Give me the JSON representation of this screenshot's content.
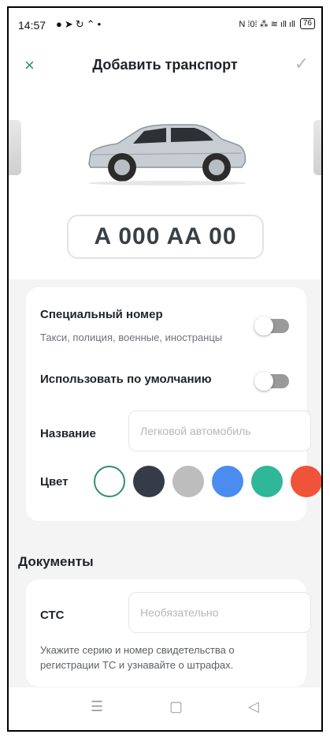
{
  "status_bar": {
    "time": "14:57",
    "left_icons": [
      "message-icon",
      "navigation-icon",
      "sync-icon",
      "up-arrow-icon",
      "dot-icon"
    ],
    "right_text": "N ⁞0⁞ ⁂ ≋ ıll ıll",
    "battery": "76"
  },
  "app_bar": {
    "close_icon": "×",
    "title": "Добавить транспорт",
    "confirm_icon": "✓"
  },
  "plate": {
    "number": "A 000 AA 00"
  },
  "settings": {
    "special_number": {
      "label": "Специальный номер",
      "subtitle": "Такси, полиция, военные, иностранцы",
      "enabled": false
    },
    "use_default": {
      "label": "Использовать по умолчанию",
      "enabled": false
    },
    "name": {
      "label": "Название",
      "placeholder": "Легковой автомобиль"
    },
    "color": {
      "label": "Цвет",
      "options": [
        "#ffffff",
        "#363c47",
        "#bdbdbd",
        "#4a8cf0",
        "#2fb79a",
        "#f0533a"
      ],
      "selected_index": 0
    }
  },
  "documents": {
    "section_title": "Документы",
    "sts": {
      "label": "СТС",
      "placeholder": "Необязательно"
    },
    "hint": "Укажите серию и номер свидетельства о регистрации ТС и узнавайте о штрафах."
  },
  "nav_bar": {
    "menu_icon": "☰",
    "home_icon": "▢",
    "back_icon": "◁"
  },
  "colors": {
    "accent": "#2f8f6e",
    "page_bg": "#f4f4f5",
    "card_bg": "#ffffff"
  }
}
